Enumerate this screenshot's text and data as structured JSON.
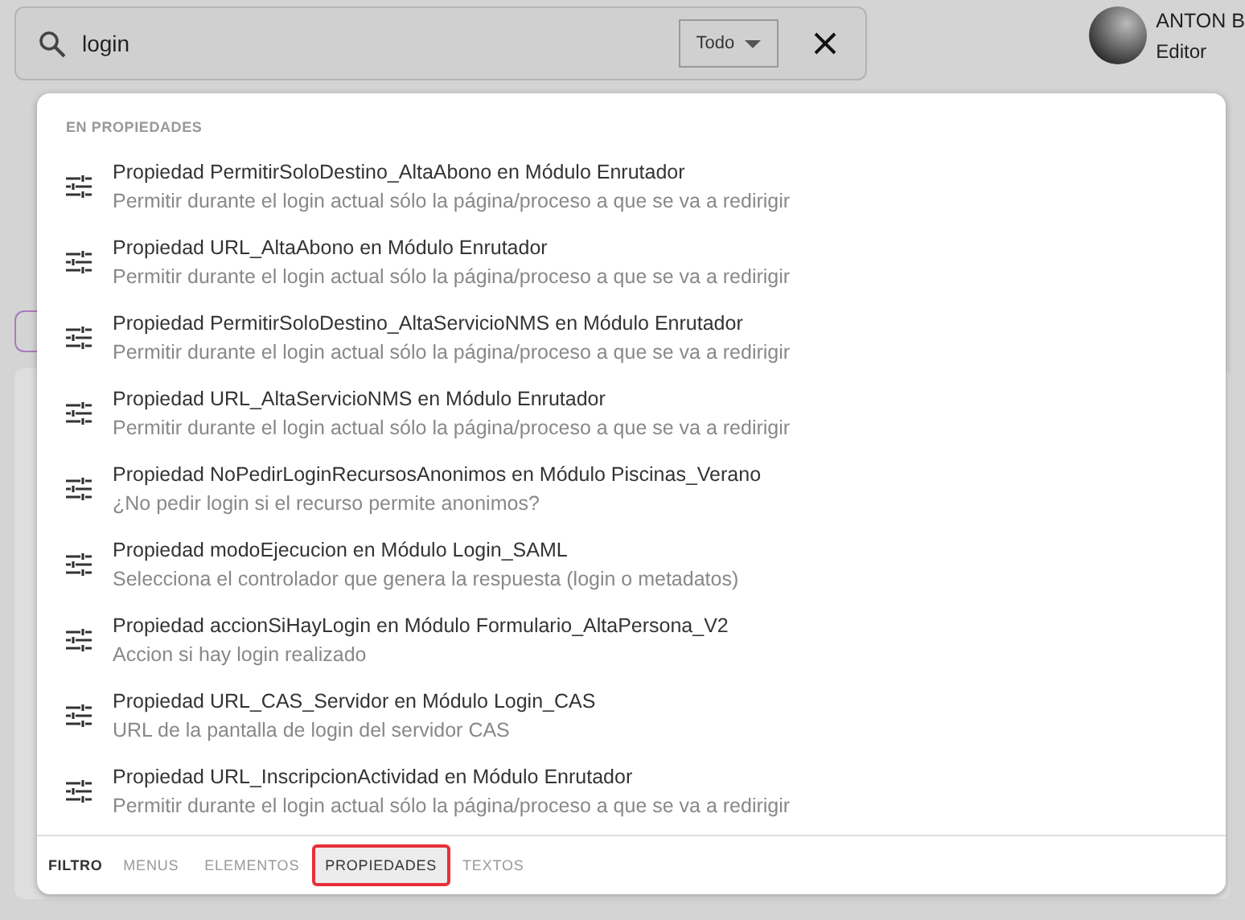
{
  "search": {
    "value": "login",
    "scope": "Todo"
  },
  "user": {
    "name": "ANTON B",
    "role": "Editor"
  },
  "results": {
    "group": "EN PROPIEDADES",
    "items": [
      {
        "title": "Propiedad PermitirSoloDestino_AltaAbono en Módulo Enrutador",
        "description": "Permitir durante el login actual sólo la página/proceso a que se va a redirigir"
      },
      {
        "title": "Propiedad URL_AltaAbono en Módulo Enrutador",
        "description": "Permitir durante el login actual sólo la página/proceso a que se va a redirigir"
      },
      {
        "title": "Propiedad PermitirSoloDestino_AltaServicioNMS en Módulo Enrutador",
        "description": "Permitir durante el login actual sólo la página/proceso a que se va a redirigir"
      },
      {
        "title": "Propiedad URL_AltaServicioNMS en Módulo Enrutador",
        "description": "Permitir durante el login actual sólo la página/proceso a que se va a redirigir"
      },
      {
        "title": "Propiedad NoPedirLoginRecursosAnonimos en Módulo Piscinas_Verano",
        "description": "¿No pedir login si el recurso permite anonimos?"
      },
      {
        "title": "Propiedad modoEjecucion en Módulo Login_SAML",
        "description": "Selecciona el controlador que genera la respuesta (login o metadatos)"
      },
      {
        "title": "Propiedad accionSiHayLogin en Módulo Formulario_AltaPersona_V2",
        "description": "Accion si hay login realizado"
      },
      {
        "title": "Propiedad URL_CAS_Servidor en Módulo Login_CAS",
        "description": "URL de la pantalla de login del servidor CAS"
      },
      {
        "title": "Propiedad URL_InscripcionActividad en Módulo Enrutador",
        "description": "Permitir durante el login actual sólo la página/proceso a que se va a redirigir"
      }
    ]
  },
  "filter": {
    "label": "FILTRO",
    "tabs": [
      {
        "label": "MENUS",
        "selected": false
      },
      {
        "label": "ELEMENTOS",
        "selected": false
      },
      {
        "label": "PROPIEDADES",
        "selected": true
      },
      {
        "label": "TEXTOS",
        "selected": false
      }
    ]
  }
}
